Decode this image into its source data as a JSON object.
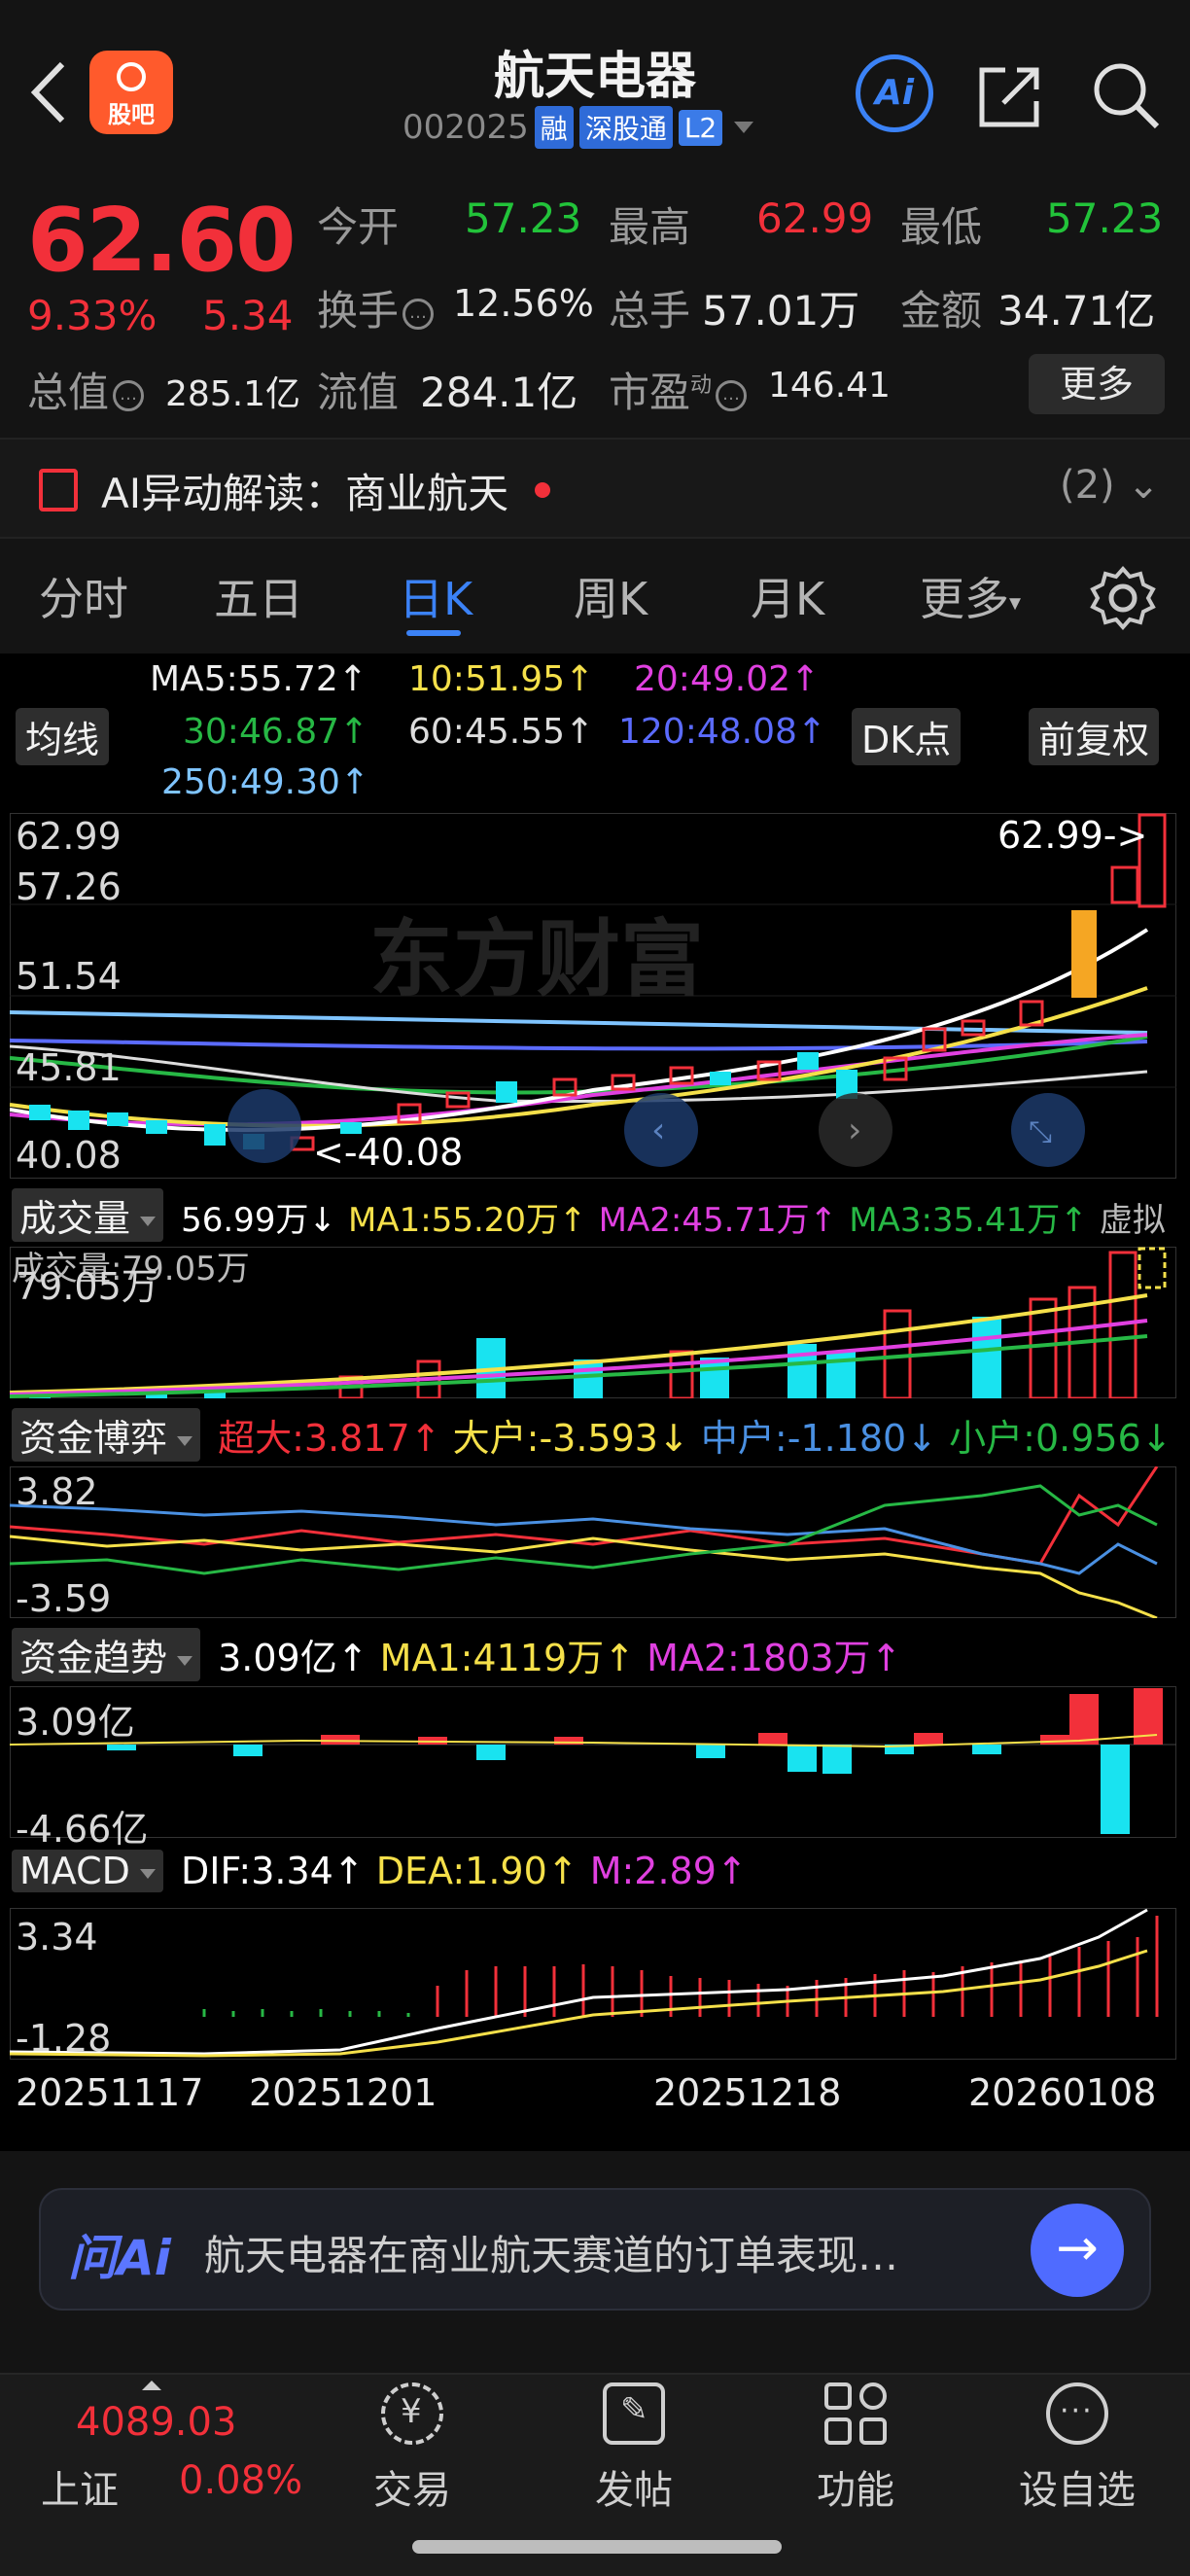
{
  "header": {
    "guba_label": "股吧",
    "title": "航天电器",
    "code": "002025",
    "tags": [
      "融",
      "深股通",
      "L2"
    ],
    "ai_label": "Ai"
  },
  "quote": {
    "price": "62.60",
    "pct": "9.33%",
    "change": "5.34",
    "total_cap_label": "总值",
    "total_cap": "285.1亿",
    "open_label": "今开",
    "open": "57.23",
    "high_label": "最高",
    "high": "62.99",
    "low_label": "最低",
    "low": "57.23",
    "turnover_label": "换手",
    "turnover": "12.56%",
    "volume_label": "总手",
    "volume": "57.01万",
    "amount_label": "金额",
    "amount": "34.71亿",
    "float_cap_label": "流值",
    "float_cap": "284.1亿",
    "pe_label": "市盈",
    "pe_sup": "动",
    "pe": "146.41",
    "more_label": "更多"
  },
  "ai_bar": {
    "text": "AI异动解读：商业航天",
    "count": "(2)"
  },
  "tabs": [
    {
      "label": "分时"
    },
    {
      "label": "五日"
    },
    {
      "label": "日K"
    },
    {
      "label": "周K"
    },
    {
      "label": "月K"
    },
    {
      "label": "更多"
    }
  ],
  "ma": {
    "button": "均线",
    "ma5": "MA5:55.72↑",
    "ma10": "10:51.95↑",
    "ma20": "20:49.02↑",
    "ma30": "30:46.87↑",
    "ma60": "60:45.55↑",
    "ma120": "120:48.08↑",
    "ma250": "250:49.30↑",
    "dk_button": "DK点",
    "adj_button": "前复权",
    "colors": {
      "ma5": "#ffffff",
      "ma10": "#f5e04a",
      "ma20": "#e040e0",
      "ma30": "#27b845",
      "ma60": "#dddddd",
      "ma120": "#5b6bff",
      "ma250": "#7fc4ff"
    }
  },
  "kline": {
    "axis": [
      "62.99",
      "57.26",
      "51.54",
      "45.81",
      "40.08"
    ],
    "max_label": "62.99->",
    "min_label": "<-40.08",
    "watermark": "东方财富"
  },
  "volume": {
    "button": "成交量",
    "value": "56.99万↓",
    "ma1": "MA1:55.20万↑",
    "ma2": "MA2:45.71万↑",
    "ma3": "MA3:35.41万↑",
    "virtual": "虚拟成交量:79.05万",
    "axis_top": "79.05万"
  },
  "fund_game": {
    "button": "资金博弈",
    "super": "超大:3.817↑",
    "large": "大户:-3.593↓",
    "mid": "中户:-1.180↓",
    "small": "小户:0.956↓",
    "axis": [
      "3.82",
      "-3.59"
    ]
  },
  "fund_trend": {
    "button": "资金趋势",
    "value": "3.09亿↑",
    "ma1": "MA1:4119万↑",
    "ma2": "MA2:1803万↑",
    "axis": [
      "3.09亿",
      "-4.66亿"
    ]
  },
  "macd": {
    "button": "MACD",
    "dif": "DIF:3.34↑",
    "dea": "DEA:1.90↑",
    "m": "M:2.89↑",
    "axis": [
      "3.34",
      "-1.28"
    ]
  },
  "dates": [
    "20251117",
    "20251201",
    "20251218",
    "20260108"
  ],
  "ask_ai": {
    "logo": "问Ai",
    "text": "航天电器在商业航天赛道的订单表现…"
  },
  "bottom_nav": {
    "index_value": "4089.03",
    "index_name": "上证",
    "index_pct": "0.08%",
    "items": [
      {
        "label": "交易"
      },
      {
        "label": "发帖"
      },
      {
        "label": "功能"
      },
      {
        "label": "设自选"
      }
    ]
  }
}
